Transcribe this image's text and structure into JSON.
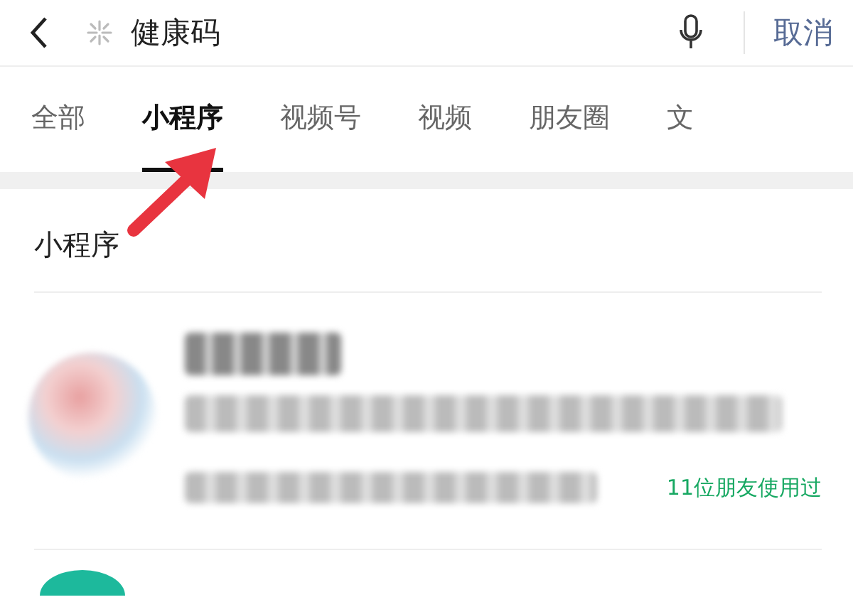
{
  "search": {
    "query": "健康码",
    "cancel": "取消"
  },
  "tabs": [
    {
      "label": "全部",
      "selected": false
    },
    {
      "label": "小程序",
      "selected": true
    },
    {
      "label": "视频号",
      "selected": false
    },
    {
      "label": "视频",
      "selected": false
    },
    {
      "label": "朋友圈",
      "selected": false
    },
    {
      "label": "文",
      "selected": false
    }
  ],
  "section": {
    "title": "小程序"
  },
  "results": [
    {
      "friends": "11位朋友使用过"
    }
  ]
}
